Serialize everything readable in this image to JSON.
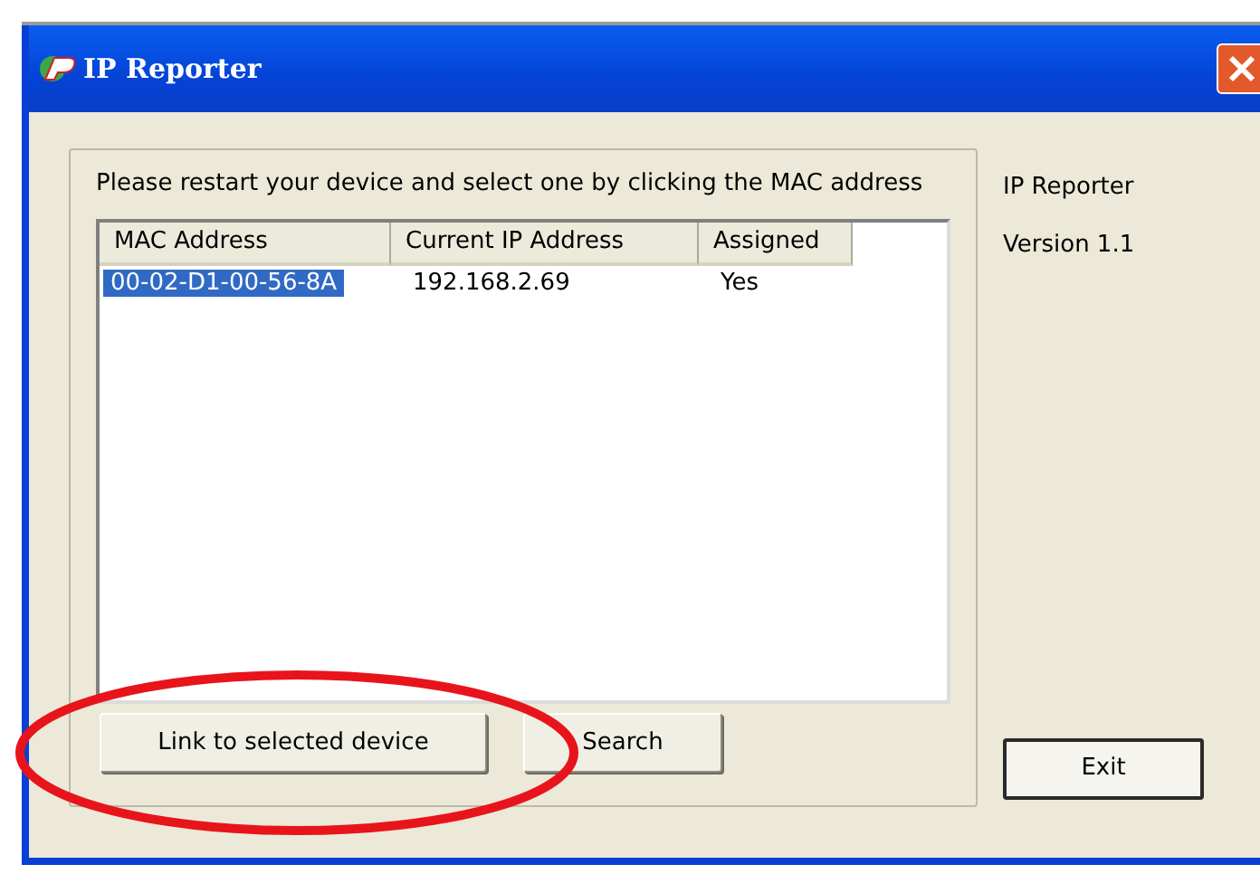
{
  "window": {
    "title": "IP Reporter"
  },
  "instruction": "Please restart your device and select one by clicking the MAC address",
  "device_list": {
    "columns": [
      "MAC Address",
      "Current IP Address",
      "Assigned"
    ],
    "rows": [
      {
        "cells": [
          "00-02-D1-00-56-8A",
          "192.168.2.69",
          "Yes"
        ],
        "selected": true
      }
    ]
  },
  "buttons": [
    "Link to selected device",
    "Search"
  ],
  "about": {
    "name": "IP Reporter",
    "version": "Version 1.1"
  },
  "exit_button": "Exit",
  "annotation": {
    "kind": "ellipse",
    "color": "#e8141c"
  }
}
